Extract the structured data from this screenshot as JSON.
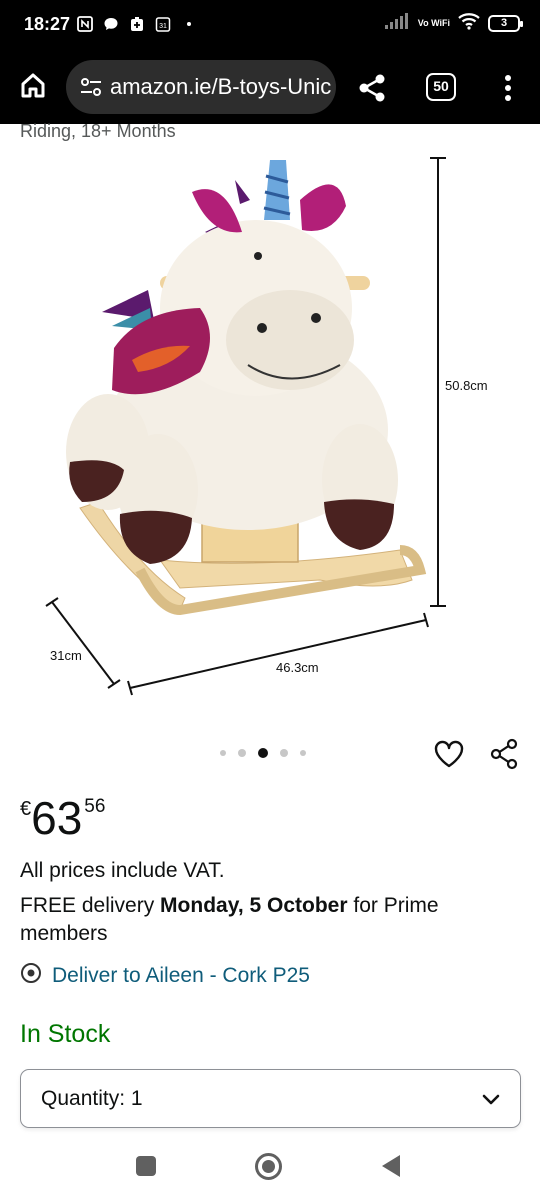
{
  "status_bar": {
    "time": "18:27",
    "network_label": "Vo WiFi",
    "battery": "3"
  },
  "browser": {
    "url": "amazon.ie/B-toys-Unic",
    "tab_count": "50"
  },
  "product": {
    "title_fragment": "Riding, 18+ Months",
    "image": {
      "dim_height": "50.8cm",
      "dim_width": "46.3cm",
      "dim_depth": "31cm"
    },
    "carousel": {
      "count": 5,
      "active_index": 2
    },
    "price": {
      "symbol": "€",
      "whole": "63",
      "fraction": "56"
    },
    "vat_note": "All prices include VAT.",
    "delivery": {
      "prefix": "FREE delivery ",
      "date": "Monday, 5 October",
      "suffix": " for Prime members"
    },
    "deliver_to": "Deliver to Aileen - Cork P25",
    "stock": "In Stock",
    "quantity_label": "Quantity: 1"
  },
  "colors": {
    "link": "#0f5c7a",
    "in_stock": "#007600",
    "toolbar_bg": "#000000"
  }
}
